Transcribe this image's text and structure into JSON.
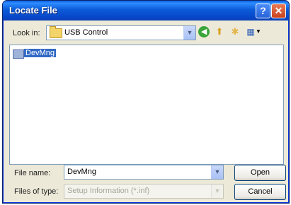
{
  "window": {
    "title": "Locate File",
    "help_glyph": "?",
    "close_glyph": "✕"
  },
  "toolbar": {
    "lookin_label": "Look in:",
    "lookin_value": "USB Control",
    "back_icon": "back-icon",
    "up_icon": "up-folder-icon",
    "new_folder_icon": "new-folder-icon",
    "views_icon": "views-menu-icon"
  },
  "file_list": {
    "items": [
      {
        "label": "DevMng",
        "icon": "folder-icon",
        "selected": true
      }
    ]
  },
  "form": {
    "file_name_label": "File name:",
    "file_name_value": "DevMng",
    "file_type_label": "Files of type:",
    "file_type_value": "Setup Information (*.inf)"
  },
  "buttons": {
    "open_label": "Open",
    "cancel_label": "Cancel"
  },
  "colors": {
    "titlebar": "#0a5fe3",
    "selection": "#316ac5",
    "dialog_bg": "#ece9d8"
  }
}
